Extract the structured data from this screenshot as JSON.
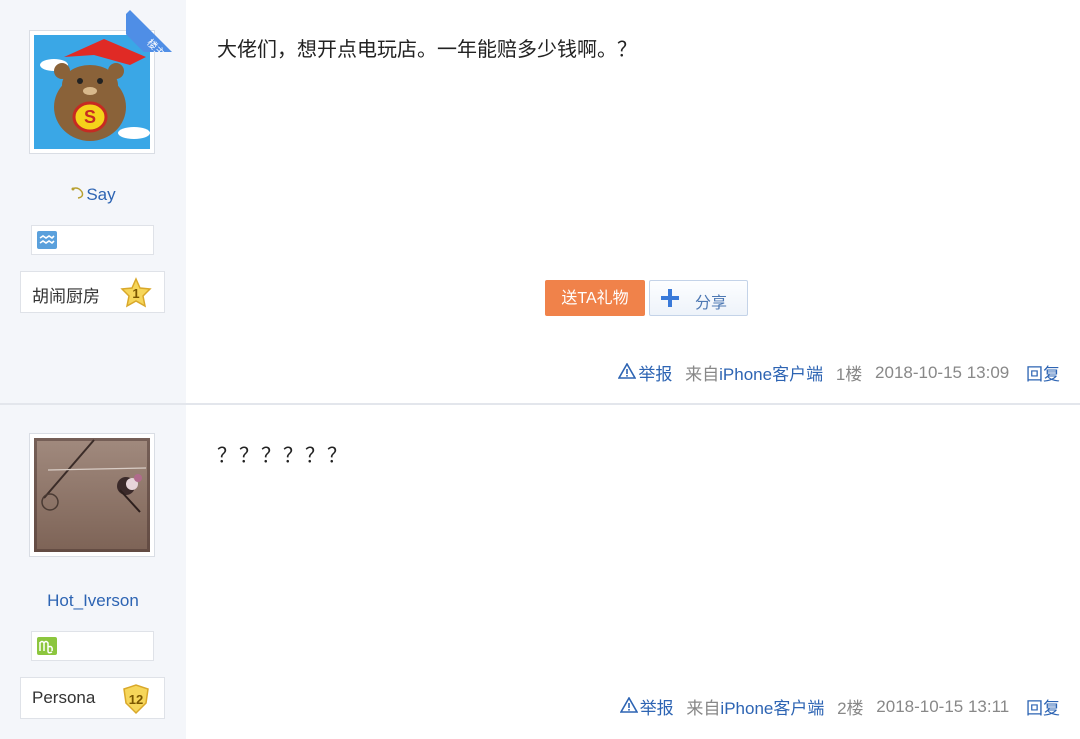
{
  "posts": [
    {
      "author": "Say",
      "author_prefix_icon": "fish-hook-icon",
      "is_op_label": "楼主",
      "zodiac_icon": "aquarius-icon",
      "badge_name": "胡闹厨房",
      "badge_level": "1",
      "content": "大佬们，想开点电玩店。一年能赔多少钱啊。？",
      "gift_button": "送TA礼物",
      "share_button": "分享",
      "report": "举报",
      "source_prefix": "来自",
      "source_device": "iPhone客户端",
      "floor": "1楼",
      "time": "2018-10-15 13:09",
      "reply": "回复"
    },
    {
      "author": "Hot_Iverson",
      "zodiac_icon": "virgo-icon",
      "badge_name": "Persona",
      "badge_level": "12",
      "content": "？？？？？？",
      "report": "举报",
      "source_prefix": "来自",
      "source_device": "iPhone客户端",
      "floor": "2楼",
      "time": "2018-10-15 13:11",
      "reply": "回复"
    }
  ],
  "colors": {
    "link": "#2d64b3",
    "gift_button": "#f0824a",
    "sidebar_bg": "#f4f6fa",
    "op_ribbon": "#4f8ee6"
  }
}
